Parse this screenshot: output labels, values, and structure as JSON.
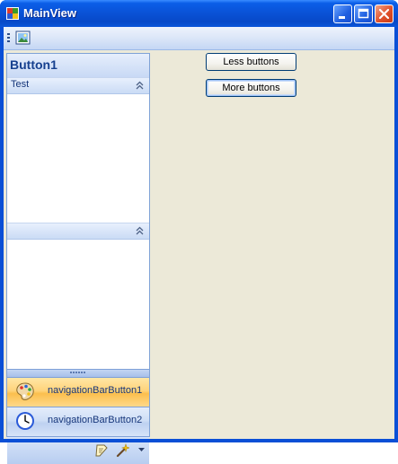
{
  "window": {
    "title": "MainView"
  },
  "toolstrip": {
    "items": [
      {
        "icon": "image-icon"
      }
    ]
  },
  "navbar": {
    "header": "Button1",
    "groups": [
      {
        "label": "Test",
        "icon": "collapse-chevrons-icon"
      },
      {
        "label": "",
        "icon": "collapse-chevrons-icon"
      }
    ],
    "buttons": [
      {
        "label": "navigationBarButton1",
        "icon": "palette-icon",
        "state": "selected"
      },
      {
        "label": "navigationBarButton2",
        "icon": "clock-icon",
        "state": "normal"
      }
    ],
    "overflow_icons": [
      "notepad-icon",
      "magic-wand-icon",
      "chevron-down-icon"
    ]
  },
  "buttons": {
    "less": "Less buttons",
    "more": "More buttons"
  },
  "colors": {
    "accent": "#0a53d8",
    "selected": "#fbbf4d",
    "header_text": "#16408f"
  }
}
